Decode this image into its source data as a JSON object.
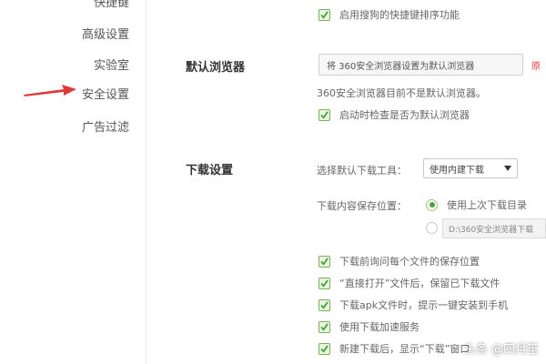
{
  "sidebar": {
    "items": [
      {
        "label": "快捷键"
      },
      {
        "label": "高级设置"
      },
      {
        "label": "实验室"
      },
      {
        "label": "安全设置"
      },
      {
        "label": "广告过滤"
      }
    ]
  },
  "top": {
    "checkbox_label": "启用搜狗的快捷键排序功能"
  },
  "default_browser": {
    "title": "默认浏览器",
    "set_button": "将 360安全浏览器设置为默认浏览器",
    "side_link": "原",
    "status_text": "360安全浏览器目前不是默认浏览器。",
    "check_label": "启动时检查是否为默认浏览器"
  },
  "download": {
    "title": "下载设置",
    "tool_label": "选择默认下载工具：",
    "tool_value": "使用内建下载",
    "location_label": "下载内容保存位置：",
    "location_last": "使用上次下载目录",
    "location_custom_path": "D:\\360安全浏览器下载",
    "checkbox_items": [
      {
        "label": "下载前询问每个文件的保存位置"
      },
      {
        "label": "“直接打开”文件后，保留已下载文件"
      },
      {
        "label": "下载apk文件时，提示一键安装到手机"
      },
      {
        "label": "使用下载加速服务"
      },
      {
        "label": "新建下载后，显示“下载”窗口"
      }
    ]
  },
  "watermark": "头条 @四月笙",
  "colors": {
    "arrow": "#e2383a",
    "check_green": "#46a23b",
    "link_red": "#e23b3b"
  },
  "icons": {
    "arrow": "red-arrow-icon",
    "check": "checkmark-icon",
    "dropdown": "triangle-down-icon"
  }
}
